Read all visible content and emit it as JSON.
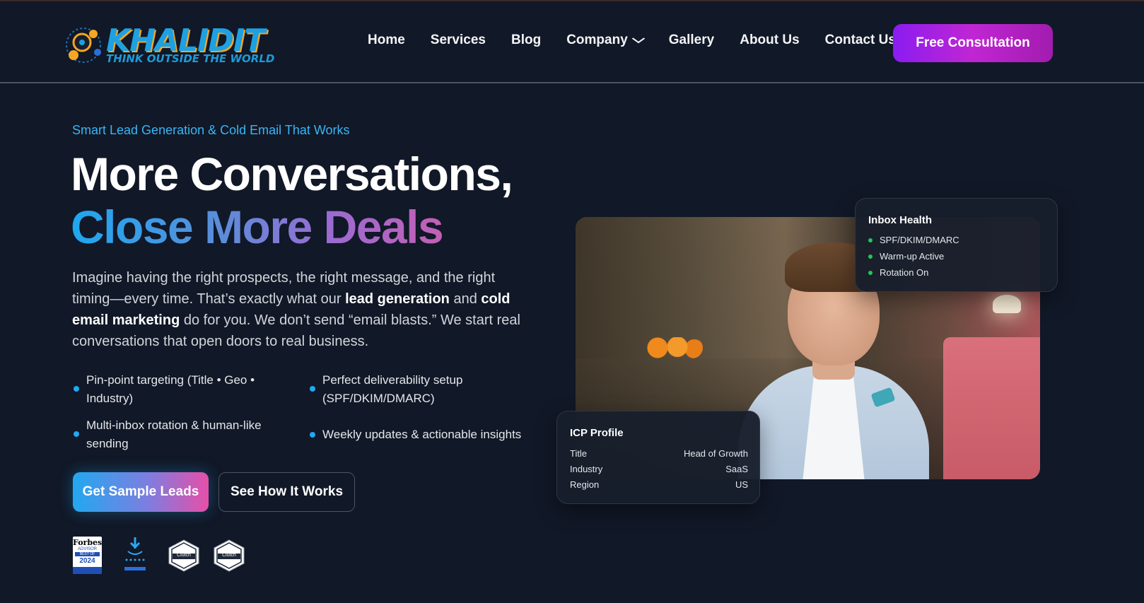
{
  "brand": {
    "name": "KHALIDIT",
    "tagline": "THINK OUTSIDE THE WORLD"
  },
  "nav": {
    "items": [
      {
        "label": "Home"
      },
      {
        "label": "Services"
      },
      {
        "label": "Blog"
      },
      {
        "label": "Company",
        "has_dropdown": true
      },
      {
        "label": "Gallery"
      },
      {
        "label": "About Us"
      },
      {
        "label": "Contact Us"
      }
    ],
    "cta_label": "Free Consultation"
  },
  "hero": {
    "eyebrow": "Smart Lead Generation & Cold Email That Works",
    "headline_line1": "More Conversations,",
    "headline_line2": "Close More Deals",
    "lead": {
      "part1": "Imagine having the right prospects, the right message, and the right timing—every time. That’s exactly what our ",
      "bold1": "lead generation",
      "part2": " and ",
      "bold2": "cold email marketing",
      "part3": " do for you. We don’t send “email blasts.” We start real conversations that open doors to real business."
    },
    "bullets": [
      "Pin-point targeting (Title • Geo • Industry)",
      "Perfect deliverability setup (SPF/DKIM/DMARC)",
      "Multi-inbox rotation & human-like sending",
      "Weekly updates & actionable insights"
    ],
    "primary_button": "Get Sample Leads",
    "secondary_button": "See How It Works"
  },
  "badges": {
    "forbes": {
      "line1": "Forbes",
      "line2": "ADVISOR",
      "line3": "BEST OF",
      "year": "2024"
    },
    "clutch1": "Clutch",
    "clutch2": "Clutch"
  },
  "inbox_health": {
    "title": "Inbox Health",
    "items": [
      "SPF/DKIM/DMARC",
      "Warm-up Active",
      "Rotation On"
    ]
  },
  "icp_profile": {
    "title": "ICP Profile",
    "rows": [
      {
        "label": "Title",
        "value": "Head of Growth"
      },
      {
        "label": "Industry",
        "value": "SaaS"
      },
      {
        "label": "Region",
        "value": "US"
      }
    ]
  },
  "colors": {
    "background": "#111827",
    "accent_blue": "#22a8f0",
    "accent_purple": "#8b1cf0",
    "accent_pink": "#e64fa8",
    "status_green": "#22c55e"
  }
}
